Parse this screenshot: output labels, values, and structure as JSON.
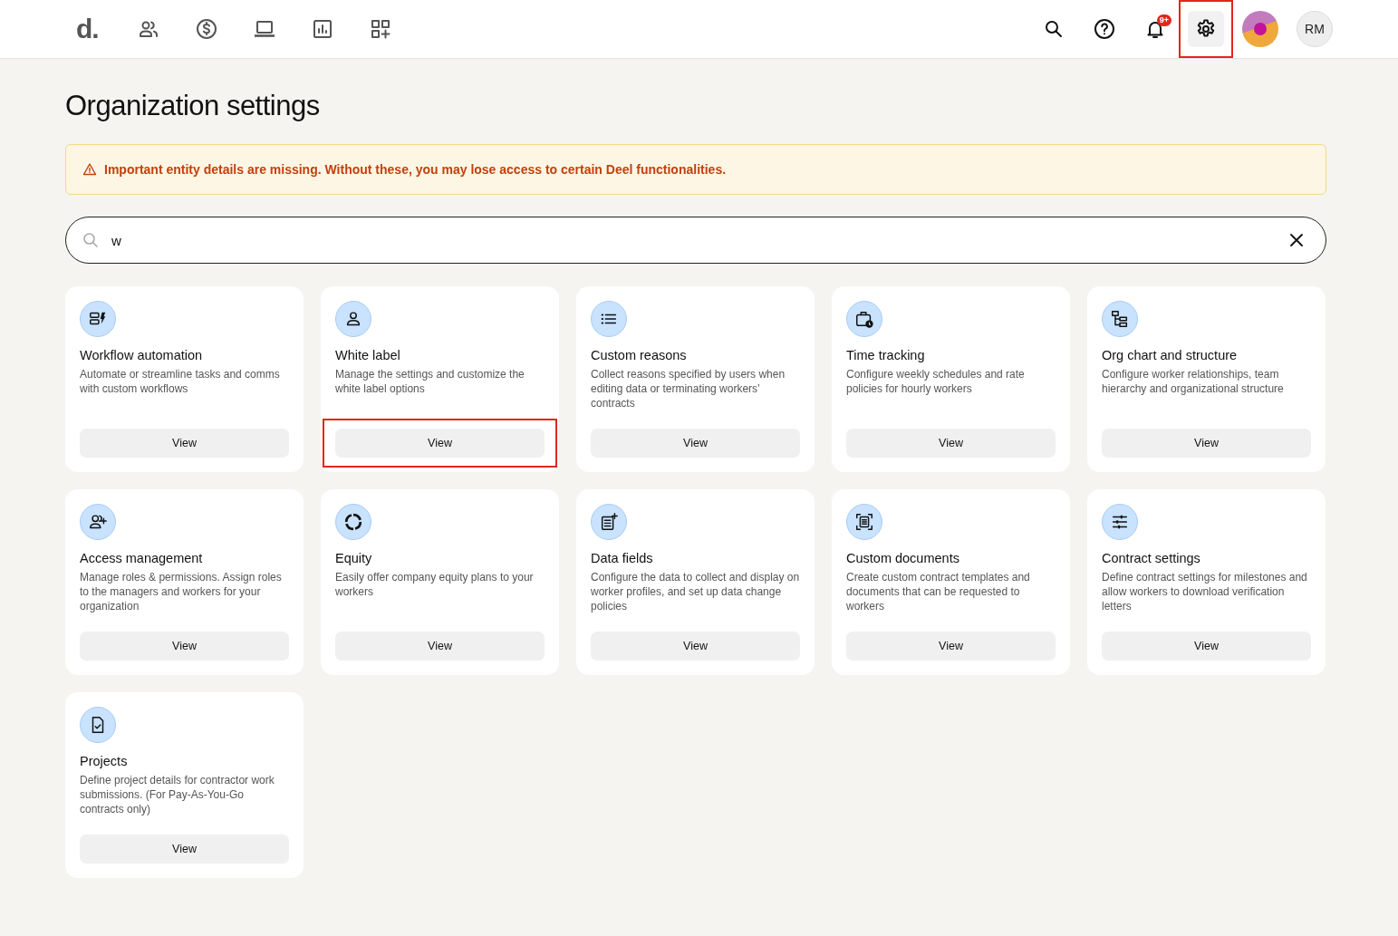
{
  "header": {
    "logo": "d.",
    "nav": [
      {
        "selected": false
      },
      {
        "selected": false
      },
      {
        "selected": false
      },
      {
        "selected": false
      },
      {
        "selected": false
      }
    ],
    "tools": [
      {
        "kind": "search",
        "selected": false,
        "highlighted": false
      },
      {
        "kind": "help",
        "selected": false,
        "highlighted": false
      },
      {
        "kind": "notifications",
        "badge": "9+",
        "selected": false,
        "highlighted": false
      },
      {
        "kind": "settings",
        "selected": true,
        "highlighted": true
      }
    ],
    "avatar_initials": "RM"
  },
  "title": "Organization settings",
  "alert": {
    "text": "Important entity details are missing. Without these, you may lose access to certain Deel functionalities."
  },
  "search": {
    "value": "w"
  },
  "cards": [
    {
      "title": "Workflow automation",
      "description": "Automate or streamline tasks and comms with custom workflows",
      "button": "View",
      "highlighted": false
    },
    {
      "title": "White label",
      "description": "Manage the settings and customize the white label options",
      "button": "View",
      "highlighted": true
    },
    {
      "title": "Custom reasons",
      "description": "Collect reasons specified by users when editing data or terminating workers’ contracts",
      "button": "View",
      "highlighted": false
    },
    {
      "title": "Time tracking",
      "description": "Configure weekly schedules and rate policies for hourly workers",
      "button": "View",
      "highlighted": false
    },
    {
      "title": "Org chart and structure",
      "description": "Configure worker relationships, team hierarchy and organizational structure",
      "button": "View",
      "highlighted": false
    },
    {
      "title": "Access management",
      "description": "Manage roles & permissions. Assign roles to the managers and workers for your organization",
      "button": "View",
      "highlighted": false
    },
    {
      "title": "Equity",
      "description": "Easily offer company equity plans to your workers",
      "button": "View",
      "highlighted": false
    },
    {
      "title": "Data fields",
      "description": "Configure the data to collect and display on worker profiles, and set up data change policies",
      "button": "View",
      "highlighted": false
    },
    {
      "title": "Custom documents",
      "description": "Create custom contract templates and documents that can be requested to workers",
      "button": "View",
      "highlighted": false
    },
    {
      "title": "Contract settings",
      "description": "Define contract settings for milestones and allow workers to download verification letters",
      "button": "View",
      "highlighted": false
    },
    {
      "title": "Projects",
      "description": "Define project details for contractor work submissions. (For Pay-As-You-Go contracts only)",
      "button": "View",
      "highlighted": false
    }
  ]
}
